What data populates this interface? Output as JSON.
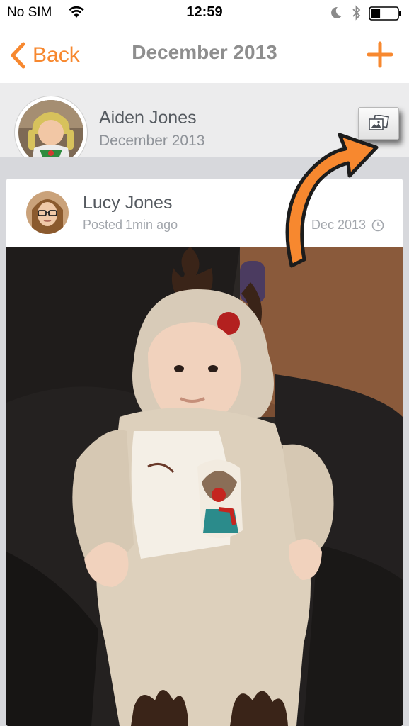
{
  "status_bar": {
    "carrier": "No SIM",
    "time": "12:59",
    "battery_level": 0.35
  },
  "nav": {
    "back_label": "Back",
    "title": "December 2013",
    "add_icon": "plus-icon"
  },
  "profile": {
    "name": "Aiden Jones",
    "date": "December 2013",
    "gallery_icon": "photo-gallery-icon"
  },
  "post": {
    "author": "Lucy Jones",
    "posted_prefix": "Posted",
    "posted_ago": "1min ago",
    "date": "Dec 2013",
    "date_icon": "clock-icon"
  },
  "colors": {
    "accent": "#f7882f",
    "title_gray": "#8e8e8e",
    "header_bg": "#ececed"
  }
}
